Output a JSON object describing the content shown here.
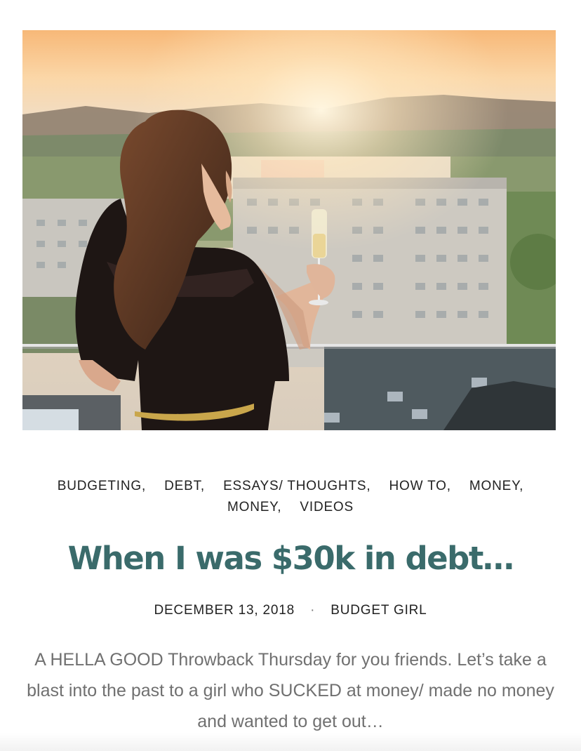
{
  "post": {
    "image_alt": "Woman holding champagne on a balcony overlooking a city at sunset",
    "categories": [
      "BUDGETING,",
      "DEBT,",
      "ESSAYS/ THOUGHTS,",
      "HOW TO,",
      "MONEY,",
      "MONEY,",
      "VIDEOS"
    ],
    "title": "When I was $30k in debt…",
    "date": "DECEMBER 13, 2018",
    "separator": "·",
    "author": "BUDGET GIRL",
    "excerpt": "A HELLA GOOD Throwback Thursday for you friends. Let’s take a blast into the past to a girl who SUCKED at money/ made no money and wanted to get out…"
  },
  "colors": {
    "title": "#3a6b6b",
    "meta_text": "#222222",
    "excerpt_text": "#707070"
  }
}
